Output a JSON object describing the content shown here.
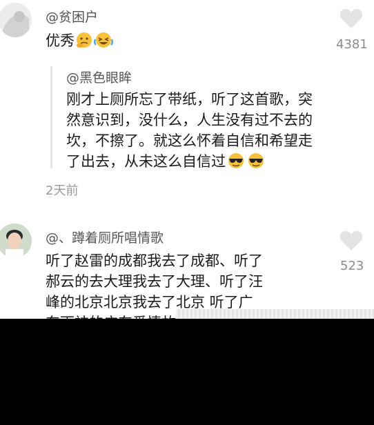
{
  "comments": [
    {
      "username": "@贫困户",
      "text": "优秀",
      "likes": "4381",
      "reply": {
        "username": "@黑色眼眸",
        "lines": [
          "刚才上厕所忘了带纸，听了这首歌，突",
          "然意识到，没什么，人生没有过不去的",
          "坎，不擦了。就这么怀着自信和希望走",
          "了出去，从未这么自信过"
        ]
      },
      "time": "2天前"
    },
    {
      "username": "@、蹲着厕所唱情歌",
      "lines": [
        "听了赵雷的成都我去了成都、听了",
        "郝云的去大理我去了大理、听了汪",
        "峰的北京北京我去了北京 听了广",
        "东雨神的广东爱情故事"
      ],
      "likes": "523"
    }
  ],
  "icons": {
    "like": "heart-icon",
    "emoji_1": "thinking-face-emoji",
    "emoji_2": "laughing-crying-emoji",
    "emoji_3": "cool-sunglasses-emoji"
  },
  "colors": {
    "heart": "#e3e3e3",
    "username": "#555555",
    "muted": "#8a8a8a"
  }
}
